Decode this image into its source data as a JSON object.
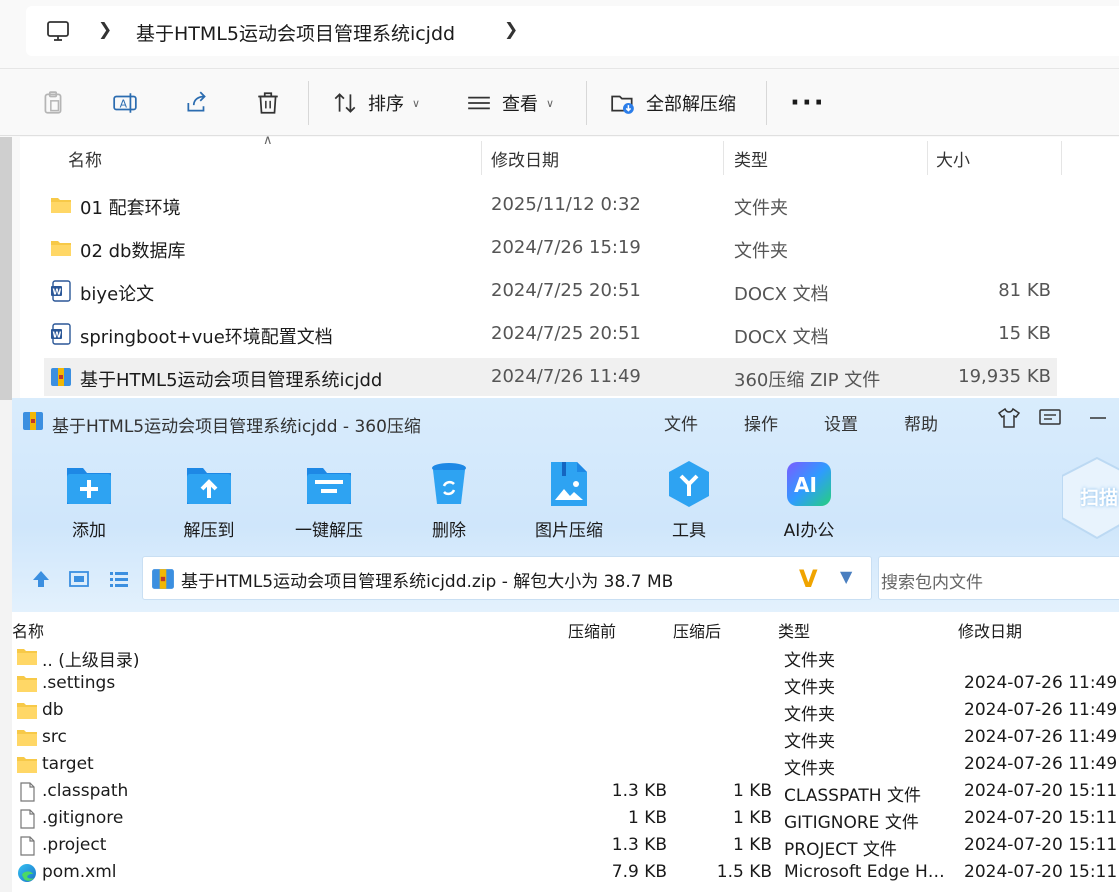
{
  "explorer": {
    "breadcrumb": "基于HTML5运动会项目管理系统icjdd",
    "toolbar": {
      "sort_label": "排序",
      "view_label": "查看",
      "extract_all_label": "全部解压缩"
    },
    "columns": {
      "name": "名称",
      "date": "修改日期",
      "type": "类型",
      "size": "大小"
    },
    "files": [
      {
        "name": "01 配套环境",
        "date": "2025/11/12 0:32",
        "type": "文件夹",
        "size": "",
        "icon": "folder-icon"
      },
      {
        "name": "02 db数据库",
        "date": "2024/7/26 15:19",
        "type": "文件夹",
        "size": "",
        "icon": "folder-icon"
      },
      {
        "name": "biye论文",
        "date": "2024/7/25 20:51",
        "type": "DOCX 文档",
        "size": "81 KB",
        "icon": "word-doc-icon"
      },
      {
        "name": "springboot+vue环境配置文档",
        "date": "2024/7/25 20:51",
        "type": "DOCX 文档",
        "size": "15 KB",
        "icon": "word-doc-icon"
      },
      {
        "name": "基于HTML5运动会项目管理系统icjdd",
        "date": "2024/7/26 11:49",
        "type": "360压缩 ZIP 文件",
        "size": "19,935 KB",
        "icon": "zip-archive-icon"
      }
    ]
  },
  "zip": {
    "title": "基于HTML5运动会项目管理系统icjdd - 360压缩",
    "menu": [
      "文件",
      "操作",
      "设置",
      "帮助"
    ],
    "tools": [
      {
        "label": "添加",
        "icon": "add-folder-icon"
      },
      {
        "label": "解压到",
        "icon": "extract-to-icon"
      },
      {
        "label": "一键解压",
        "icon": "one-click-extract-icon"
      },
      {
        "label": "删除",
        "icon": "recycle-bin-icon"
      },
      {
        "label": "图片压缩",
        "icon": "image-compress-icon"
      },
      {
        "label": "工具",
        "icon": "tools-icon"
      },
      {
        "label": "AI办公",
        "icon": "ai-office-icon"
      }
    ],
    "scan_label": "扫描",
    "path_text": "基于HTML5运动会项目管理系统icjdd.zip - 解包大小为 38.7 MB",
    "search_placeholder": "搜索包内文件",
    "columns": {
      "name": "名称",
      "before": "压缩前",
      "after": "压缩后",
      "type": "类型",
      "date": "修改日期"
    },
    "files": [
      {
        "name": ".. (上级目录)",
        "before": "",
        "after": "",
        "type": "文件夹",
        "date": "",
        "icon": "folder-icon"
      },
      {
        "name": ".settings",
        "before": "",
        "after": "",
        "type": "文件夹",
        "date": "2024-07-26 11:49",
        "icon": "folder-icon"
      },
      {
        "name": "db",
        "before": "",
        "after": "",
        "type": "文件夹",
        "date": "2024-07-26 11:49",
        "icon": "folder-icon"
      },
      {
        "name": "src",
        "before": "",
        "after": "",
        "type": "文件夹",
        "date": "2024-07-26 11:49",
        "icon": "folder-icon"
      },
      {
        "name": "target",
        "before": "",
        "after": "",
        "type": "文件夹",
        "date": "2024-07-26 11:49",
        "icon": "folder-icon"
      },
      {
        "name": ".classpath",
        "before": "1.3 KB",
        "after": "1 KB",
        "type": "CLASSPATH 文件",
        "date": "2024-07-20 15:11",
        "icon": "file-icon"
      },
      {
        "name": ".gitignore",
        "before": "1 KB",
        "after": "1 KB",
        "type": "GITIGNORE 文件",
        "date": "2024-07-20 15:11",
        "icon": "file-icon"
      },
      {
        "name": ".project",
        "before": "1.3 KB",
        "after": "1 KB",
        "type": "PROJECT 文件",
        "date": "2024-07-20 15:11",
        "icon": "file-icon"
      },
      {
        "name": "pom.xml",
        "before": "7.9 KB",
        "after": "1.5 KB",
        "type": "Microsoft Edge HTML Document",
        "date": "2024-07-20 15:11",
        "icon": "edge-icon"
      }
    ]
  }
}
